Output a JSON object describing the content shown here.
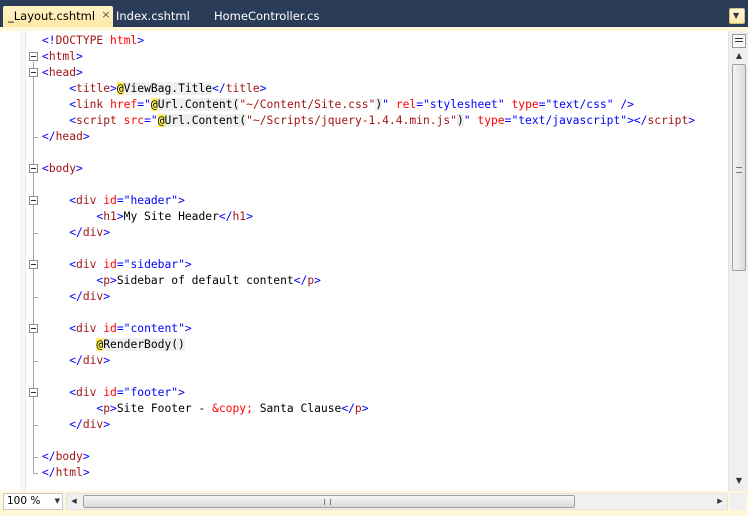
{
  "tabs": [
    {
      "label": "_Layout.cshtml",
      "active": true
    },
    {
      "label": "Index.cshtml",
      "active": false
    },
    {
      "label": "HomeController.cs",
      "active": false
    }
  ],
  "icons": {
    "tab_close": "×",
    "tab_dropdown": "▼",
    "scroll_up": "▲",
    "scroll_down": "▼",
    "scroll_left": "◀",
    "scroll_right": "▶",
    "zoom_dropdown": "▼"
  },
  "colors": {
    "tab_bar": "#2b3c59",
    "active_tab": "#ffe8a6",
    "html_delimiter": "#0000ff",
    "html_element": "#a31515",
    "html_attribute": "#ff0000",
    "attribute_value": "#0000ff",
    "razor_marker": "#ffee62"
  },
  "editor": {
    "zoom": "100 %",
    "lines": [
      {
        "indent": 0,
        "tokens": [
          [
            "del",
            "<!"
          ],
          [
            "name",
            "DOCTYPE"
          ],
          [
            "text",
            " "
          ],
          [
            "attr",
            "html"
          ],
          [
            "del",
            ">"
          ]
        ]
      },
      {
        "indent": 0,
        "tokens": [
          [
            "del",
            "<"
          ],
          [
            "name",
            "html"
          ],
          [
            "del",
            ">"
          ]
        ]
      },
      {
        "indent": 0,
        "tokens": [
          [
            "del",
            "<"
          ],
          [
            "name",
            "head"
          ],
          [
            "del",
            ">"
          ]
        ]
      },
      {
        "indent": 1,
        "tokens": [
          [
            "del",
            "<"
          ],
          [
            "name",
            "title"
          ],
          [
            "del",
            ">"
          ],
          [
            "at",
            "@"
          ],
          [
            "razor",
            "ViewBag.Title"
          ],
          [
            "del",
            "</"
          ],
          [
            "name",
            "title"
          ],
          [
            "del",
            ">"
          ]
        ]
      },
      {
        "indent": 1,
        "tokens": [
          [
            "del",
            "<"
          ],
          [
            "name",
            "link"
          ],
          [
            "text",
            " "
          ],
          [
            "attr",
            "href"
          ],
          [
            "del",
            "="
          ],
          [
            "val",
            "\""
          ],
          [
            "at",
            "@"
          ],
          [
            "razor",
            "Url.Content("
          ],
          [
            "name",
            "\"~/Content/Site.css\""
          ],
          [
            "razor",
            ")"
          ],
          [
            "val",
            "\""
          ],
          [
            "text",
            " "
          ],
          [
            "attr",
            "rel"
          ],
          [
            "del",
            "="
          ],
          [
            "val",
            "\"stylesheet\""
          ],
          [
            "text",
            " "
          ],
          [
            "attr",
            "type"
          ],
          [
            "del",
            "="
          ],
          [
            "val",
            "\"text/css\""
          ],
          [
            "text",
            " "
          ],
          [
            "del",
            "/>"
          ]
        ]
      },
      {
        "indent": 1,
        "tokens": [
          [
            "del",
            "<"
          ],
          [
            "name",
            "script"
          ],
          [
            "text",
            " "
          ],
          [
            "attr",
            "src"
          ],
          [
            "del",
            "="
          ],
          [
            "val",
            "\""
          ],
          [
            "at",
            "@"
          ],
          [
            "razor",
            "Url.Content("
          ],
          [
            "name",
            "\"~/Scripts/jquery-1.4.4.min.js\""
          ],
          [
            "razor",
            ")"
          ],
          [
            "val",
            "\""
          ],
          [
            "text",
            " "
          ],
          [
            "attr",
            "type"
          ],
          [
            "del",
            "="
          ],
          [
            "val",
            "\"text/javascript\""
          ],
          [
            "del",
            "></"
          ],
          [
            "name",
            "script"
          ],
          [
            "del",
            ">"
          ]
        ]
      },
      {
        "indent": 0,
        "tokens": [
          [
            "del",
            "</"
          ],
          [
            "name",
            "head"
          ],
          [
            "del",
            ">"
          ]
        ]
      },
      {
        "indent": 0,
        "tokens": []
      },
      {
        "indent": 0,
        "tokens": [
          [
            "del",
            "<"
          ],
          [
            "name",
            "body"
          ],
          [
            "del",
            ">"
          ]
        ]
      },
      {
        "indent": 0,
        "tokens": []
      },
      {
        "indent": 1,
        "tokens": [
          [
            "del",
            "<"
          ],
          [
            "name",
            "div"
          ],
          [
            "text",
            " "
          ],
          [
            "attr",
            "id"
          ],
          [
            "del",
            "="
          ],
          [
            "val",
            "\"header\""
          ],
          [
            "del",
            ">"
          ]
        ]
      },
      {
        "indent": 2,
        "tokens": [
          [
            "del",
            "<"
          ],
          [
            "name",
            "h1"
          ],
          [
            "del",
            ">"
          ],
          [
            "text",
            "My Site Header"
          ],
          [
            "del",
            "</"
          ],
          [
            "name",
            "h1"
          ],
          [
            "del",
            ">"
          ]
        ]
      },
      {
        "indent": 1,
        "tokens": [
          [
            "del",
            "</"
          ],
          [
            "name",
            "div"
          ],
          [
            "del",
            ">"
          ]
        ]
      },
      {
        "indent": 0,
        "tokens": []
      },
      {
        "indent": 1,
        "tokens": [
          [
            "del",
            "<"
          ],
          [
            "name",
            "div"
          ],
          [
            "text",
            " "
          ],
          [
            "attr",
            "id"
          ],
          [
            "del",
            "="
          ],
          [
            "val",
            "\"sidebar\""
          ],
          [
            "del",
            ">"
          ]
        ]
      },
      {
        "indent": 2,
        "tokens": [
          [
            "del",
            "<"
          ],
          [
            "name",
            "p"
          ],
          [
            "del",
            ">"
          ],
          [
            "text",
            "Sidebar of default content"
          ],
          [
            "del",
            "</"
          ],
          [
            "name",
            "p"
          ],
          [
            "del",
            ">"
          ]
        ]
      },
      {
        "indent": 1,
        "tokens": [
          [
            "del",
            "</"
          ],
          [
            "name",
            "div"
          ],
          [
            "del",
            ">"
          ]
        ]
      },
      {
        "indent": 0,
        "tokens": []
      },
      {
        "indent": 1,
        "tokens": [
          [
            "del",
            "<"
          ],
          [
            "name",
            "div"
          ],
          [
            "text",
            " "
          ],
          [
            "attr",
            "id"
          ],
          [
            "del",
            "="
          ],
          [
            "val",
            "\"content\""
          ],
          [
            "del",
            ">"
          ]
        ]
      },
      {
        "indent": 2,
        "tokens": [
          [
            "at",
            "@"
          ],
          [
            "razor",
            "RenderBody()"
          ]
        ]
      },
      {
        "indent": 1,
        "tokens": [
          [
            "del",
            "</"
          ],
          [
            "name",
            "div"
          ],
          [
            "del",
            ">"
          ]
        ]
      },
      {
        "indent": 0,
        "tokens": []
      },
      {
        "indent": 1,
        "tokens": [
          [
            "del",
            "<"
          ],
          [
            "name",
            "div"
          ],
          [
            "text",
            " "
          ],
          [
            "attr",
            "id"
          ],
          [
            "del",
            "="
          ],
          [
            "val",
            "\"footer\""
          ],
          [
            "del",
            ">"
          ]
        ]
      },
      {
        "indent": 2,
        "tokens": [
          [
            "del",
            "<"
          ],
          [
            "name",
            "p"
          ],
          [
            "del",
            ">"
          ],
          [
            "text",
            "Site Footer - "
          ],
          [
            "ent",
            "&copy;"
          ],
          [
            "text",
            " Santa Clause"
          ],
          [
            "del",
            "</"
          ],
          [
            "name",
            "p"
          ],
          [
            "del",
            ">"
          ]
        ]
      },
      {
        "indent": 1,
        "tokens": [
          [
            "del",
            "</"
          ],
          [
            "name",
            "div"
          ],
          [
            "del",
            ">"
          ]
        ]
      },
      {
        "indent": 0,
        "tokens": []
      },
      {
        "indent": 0,
        "tokens": [
          [
            "del",
            "</"
          ],
          [
            "name",
            "body"
          ],
          [
            "del",
            ">"
          ]
        ]
      },
      {
        "indent": 0,
        "tokens": [
          [
            "del",
            "</"
          ],
          [
            "name",
            "html"
          ],
          [
            "del",
            ">"
          ]
        ]
      }
    ]
  }
}
